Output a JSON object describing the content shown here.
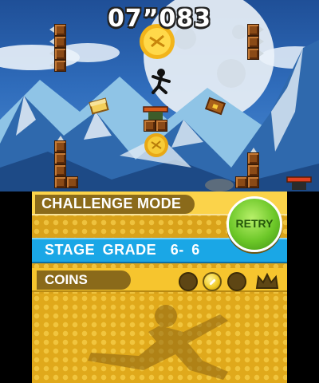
{
  "top_screen": {
    "timer": "07”083",
    "player_icon": "running-stickman-icon",
    "items": [
      "coin-icon",
      "treasure-chest-icon",
      "spring-icon"
    ]
  },
  "bottom_screen": {
    "mode_title": "CHALLENGE MODE",
    "retry_label": "RETRY",
    "stage_grade_label": "STAGE GRADE",
    "stage_grade_value": "6- 6",
    "coins_label": "COINS",
    "coins_collected": [
      false,
      true,
      false
    ],
    "crown_icon": "crown-icon",
    "colors": {
      "accent_blue": "#1aa7e6",
      "panel_gold": "#d9a21a",
      "retry_green": "#6cc728"
    }
  }
}
